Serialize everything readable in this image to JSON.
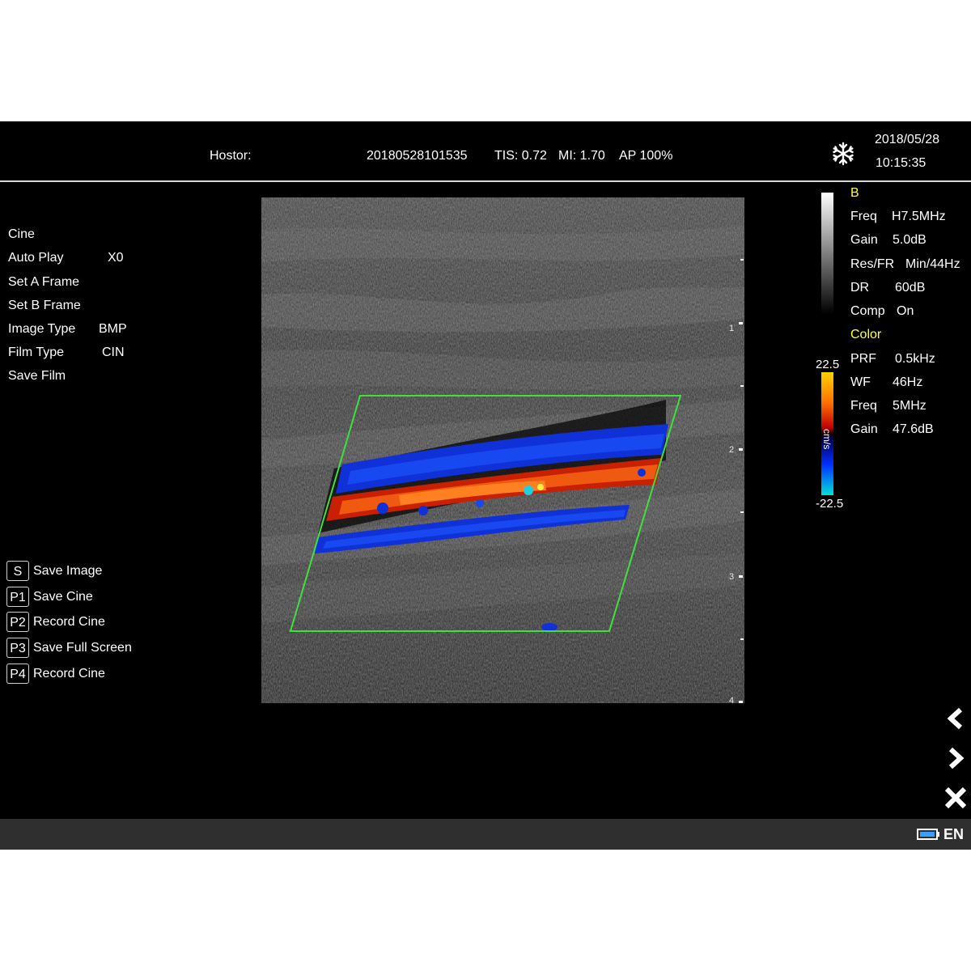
{
  "header": {
    "hospital_label": "Hostor:",
    "patient_id": "20180528101535",
    "tis": "TIS: 0.72",
    "mi": "MI: 1.70",
    "ap": "AP 100%",
    "date": "2018/05/28",
    "time": "10:15:35",
    "freeze_icon": "snowflake-icon"
  },
  "menu": {
    "items": [
      {
        "label": "Cine",
        "value": ""
      },
      {
        "label": "Auto Play",
        "value": "X0"
      },
      {
        "label": "Set A Frame",
        "value": ""
      },
      {
        "label": "Set B Frame",
        "value": ""
      },
      {
        "label": "Image Type",
        "value": "BMP"
      },
      {
        "label": "Film Type",
        "value": "CIN"
      },
      {
        "label": "Save Film",
        "value": ""
      }
    ]
  },
  "shortcuts": [
    {
      "key": "S",
      "label": "Save Image"
    },
    {
      "key": "P1",
      "label": "Save Cine"
    },
    {
      "key": "P2",
      "label": "Record Cine"
    },
    {
      "key": "P3",
      "label": "Save Full Screen"
    },
    {
      "key": "P4",
      "label": "Record Cine"
    }
  ],
  "b_mode": {
    "title": "B",
    "params": [
      {
        "key": "Freq",
        "value": "H7.5MHz"
      },
      {
        "key": "Gain",
        "value": "5.0dB"
      },
      {
        "key": "Res/FR",
        "value": "Min/44Hz"
      },
      {
        "key": "DR",
        "value": "60dB"
      },
      {
        "key": "Comp",
        "value": "On"
      }
    ]
  },
  "color_mode": {
    "title": "Color",
    "params": [
      {
        "key": "PRF",
        "value": "0.5kHz"
      },
      {
        "key": "WF",
        "value": "46Hz"
      },
      {
        "key": "Freq",
        "value": "5MHz"
      },
      {
        "key": "Gain",
        "value": "47.6dB"
      }
    ]
  },
  "color_scale": {
    "max": "22.5",
    "min": "-22.5",
    "unit": "cm/s"
  },
  "depth_scale": [
    "1",
    "2",
    "3",
    "4"
  ],
  "nav": {
    "prev_icon": "chevron-left-icon",
    "next_icon": "chevron-right-icon",
    "close_icon": "close-icon"
  },
  "status": {
    "battery_icon": "battery-icon",
    "language": "EN"
  },
  "colors": {
    "background": "#000000",
    "accent_yellow": "#ffff3c",
    "roi_box": "#3fe03f",
    "bottom_bar": "#2f2f2f"
  }
}
